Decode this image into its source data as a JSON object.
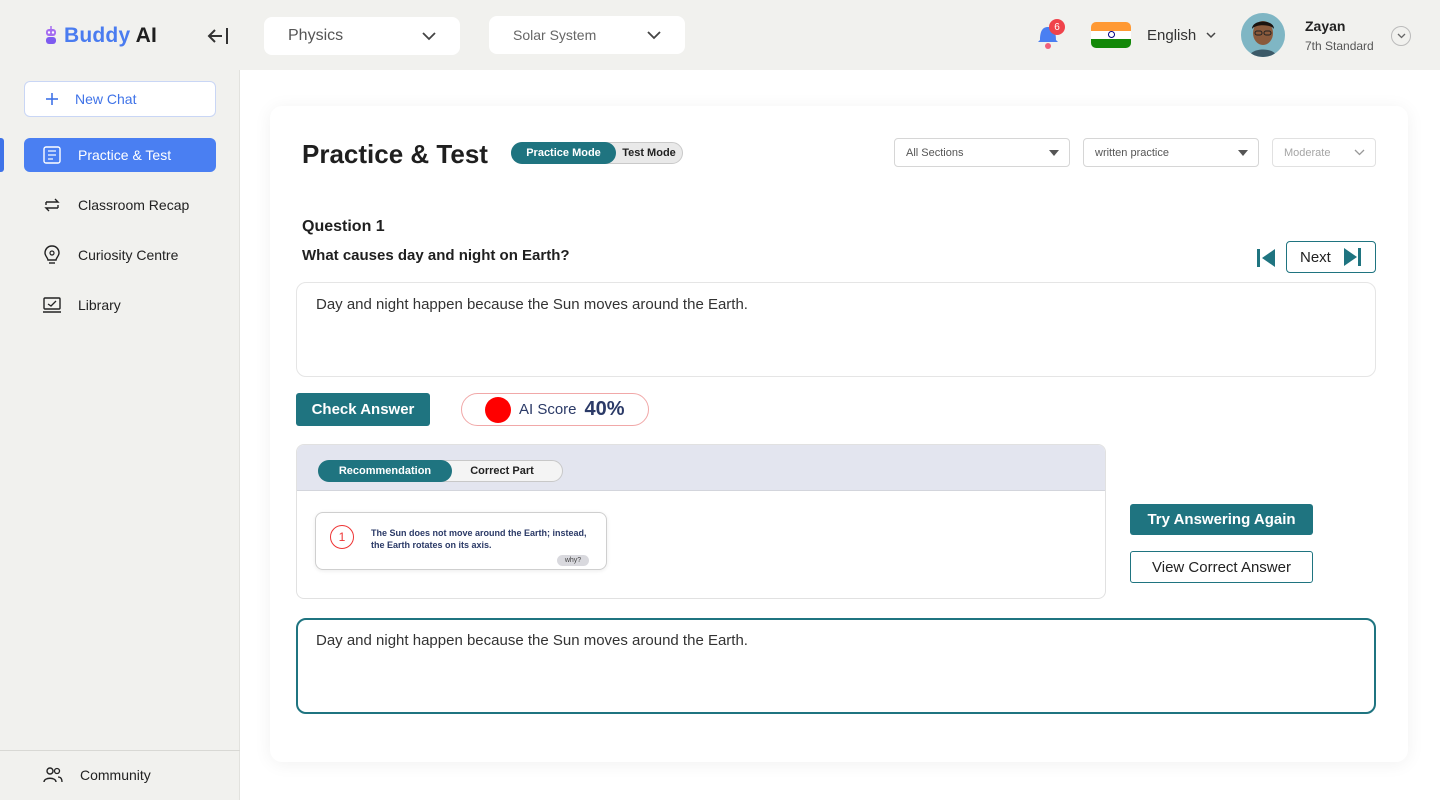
{
  "brand": {
    "name_part1": "Buddy",
    "name_part2": "AI",
    "logo_icon": "robot-icon"
  },
  "header": {
    "subject_select": {
      "value": "Physics"
    },
    "chapter_select": {
      "value": "Solar System"
    },
    "notifications": {
      "count": "6"
    },
    "language": {
      "value": "English",
      "flag": "india-flag"
    },
    "user": {
      "name": "Zayan",
      "grade": "7th Standard"
    }
  },
  "sidebar": {
    "new_chat_label": "New Chat",
    "items": [
      {
        "label": "Practice & Test",
        "icon": "practice-icon",
        "active": true
      },
      {
        "label": "Classroom Recap",
        "icon": "recap-icon",
        "active": false
      },
      {
        "label": "Curiosity Centre",
        "icon": "lightbulb-icon",
        "active": false
      },
      {
        "label": "Library",
        "icon": "library-icon",
        "active": false
      }
    ],
    "community_label": "Community"
  },
  "main": {
    "title": "Practice & Test",
    "modes": {
      "active": "Practice Mode",
      "inactive": "Test Mode"
    },
    "filters": {
      "sections": "All Sections",
      "type": "written practice",
      "level": "Moderate"
    },
    "question": {
      "number_label": "Question 1",
      "text": "What causes day and night on Earth?",
      "next_label": "Next",
      "answer": "Day and night happen because the Sun moves around the Earth."
    },
    "check_answer_label": "Check Answer",
    "ai_score": {
      "label": "AI Score",
      "value": "40%",
      "indicator_color": "#ff0000"
    },
    "feedback": {
      "tabs": {
        "active": "Recommendation",
        "inactive": "Correct Part"
      },
      "items": [
        {
          "number": "1",
          "text": "The Sun does not move around the Earth; instead, the Earth rotates on its axis.",
          "tag": "why?"
        }
      ]
    },
    "actions": {
      "try_again": "Try Answering Again",
      "view_correct": "View Correct Answer"
    },
    "edit_answer": "Day and night happen because the Sun moves around the Earth."
  },
  "colors": {
    "accent_teal": "#1f7480",
    "brand_blue": "#4a7ff2",
    "score_red": "#ff0000"
  }
}
